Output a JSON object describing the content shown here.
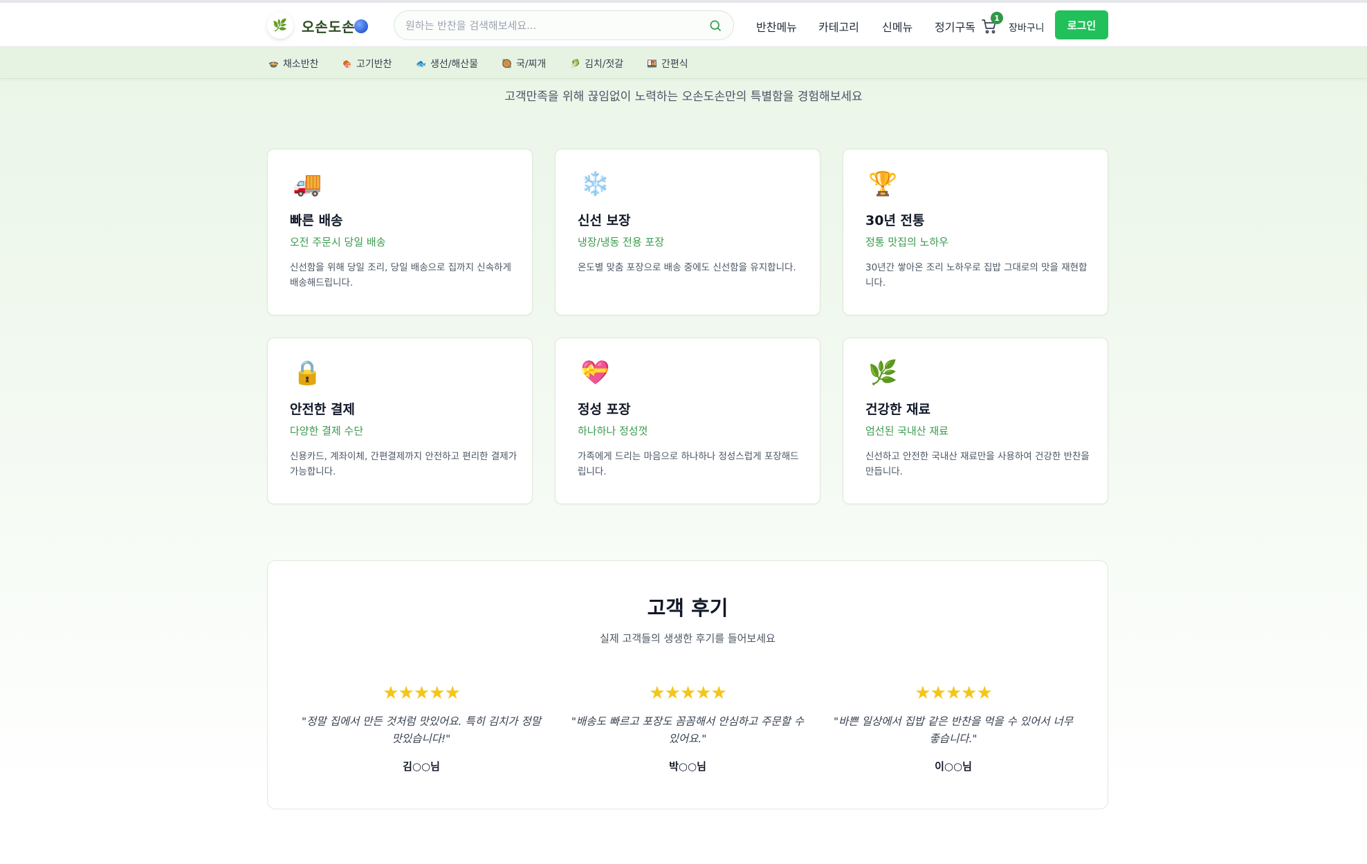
{
  "header": {
    "logo_text": "오손도손",
    "search_placeholder": "원하는 반찬을 검색해보세요...",
    "nav": [
      "반찬메뉴",
      "카테고리",
      "신메뉴",
      "정기구독"
    ],
    "cart_count": "1",
    "cart_label": "장바구니",
    "login_label": "로그인",
    "accent_color": "#22c05a"
  },
  "categories": [
    {
      "icon": "bowl-icon",
      "glyph": "🍲",
      "label": "채소반찬"
    },
    {
      "icon": "meat-icon",
      "glyph": "🍖",
      "label": "고기반찬"
    },
    {
      "icon": "fish-icon",
      "glyph": "🐟",
      "label": "생선/해산물"
    },
    {
      "icon": "stew-icon",
      "glyph": "🥘",
      "label": "국/찌개"
    },
    {
      "icon": "leaf-icon",
      "glyph": "🥬",
      "label": "김치/젓갈"
    },
    {
      "icon": "bento-icon",
      "glyph": "🍱",
      "label": "간편식"
    }
  ],
  "intro": {
    "subtitle": "고객만족을 위해 끊임없이 노력하는 오손도손만의 특별함을 경험해보세요"
  },
  "features": [
    {
      "icon": "truck-icon",
      "glyph": "🚚",
      "title": "빠른 배송",
      "subtitle": "오전 주문시 당일 배송",
      "desc": "신선함을 위해 당일 조리, 당일 배송으로 집까지 신속하게 배송해드립니다."
    },
    {
      "icon": "snowflake-icon",
      "glyph": "❄️",
      "title": "신선 보장",
      "subtitle": "냉장/냉동 전용 포장",
      "desc": "온도별 맞춤 포장으로 배송 중에도 신선함을 유지합니다."
    },
    {
      "icon": "trophy-icon",
      "glyph": "🏆",
      "title": "30년 전통",
      "subtitle": "정통 맛집의 노하우",
      "desc": "30년간 쌓아온 조리 노하우로 집밥 그대로의 맛을 재현합니다."
    },
    {
      "icon": "lock-icon",
      "glyph": "🔒",
      "title": "안전한 결제",
      "subtitle": "다양한 결제 수단",
      "desc": "신용카드, 계좌이체, 간편결제까지 안전하고 편리한 결제가 가능합니다."
    },
    {
      "icon": "gift-heart-icon",
      "glyph": "💝",
      "title": "정성 포장",
      "subtitle": "하나하나 정성껏",
      "desc": "가족에게 드리는 마음으로 하나하나 정성스럽게 포장해드립니다."
    },
    {
      "icon": "herb-icon",
      "glyph": "🌿",
      "title": "건강한 재료",
      "subtitle": "엄선된 국내산 재료",
      "desc": "신선하고 안전한 국내산 재료만을 사용하여 건강한 반찬을 만듭니다."
    }
  ],
  "reviews": {
    "title": "고객 후기",
    "subtitle": "실제 고객들의 생생한 후기를 들어보세요",
    "items": [
      {
        "rating": 5,
        "stars": "★★★★★",
        "text": "\"정말 집에서 만든 것처럼 맛있어요. 특히 김치가 정말 맛있습니다!\"",
        "author": "김○○님"
      },
      {
        "rating": 5,
        "stars": "★★★★★",
        "text": "\"배송도 빠르고 포장도 꼼꼼해서 안심하고 주문할 수 있어요.\"",
        "author": "박○○님"
      },
      {
        "rating": 5,
        "stars": "★★★★★",
        "text": "\"바쁜 일상에서 집밥 같은 반찬을 먹을 수 있어서 너무 좋습니다.\"",
        "author": "이○○님"
      }
    ]
  }
}
